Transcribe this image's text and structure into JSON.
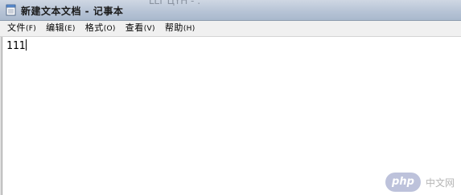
{
  "window": {
    "title": "新建文本文档 - 记事本",
    "background_residue": "ԼLT ЦYН  -   .  "
  },
  "menu": {
    "items": [
      {
        "label": "文件",
        "key": "(F)"
      },
      {
        "label": "编辑",
        "key": "(E)"
      },
      {
        "label": "格式",
        "key": "(O)"
      },
      {
        "label": "查看",
        "key": "(V)"
      },
      {
        "label": "帮助",
        "key": "(H)"
      }
    ]
  },
  "editor": {
    "content": "111"
  },
  "watermark": {
    "logo_text": "php",
    "site_text": "中文网"
  },
  "colors": {
    "titlebar_top": "#cfd7e3",
    "titlebar_bottom": "#a8b8cc",
    "menubar_bg": "#f0f0f0",
    "editor_bg": "#ffffff",
    "php_logo": "#8892bf"
  },
  "icons": {
    "title_icon": "notepad-icon"
  }
}
